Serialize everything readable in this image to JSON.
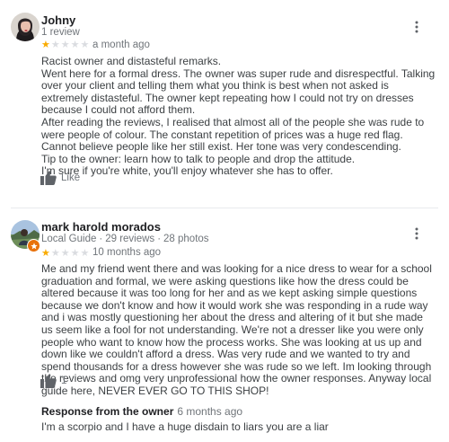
{
  "reviews": [
    {
      "author": "Johny",
      "meta": "1 review",
      "rating": 1,
      "time": "a month ago",
      "text": [
        "Racist owner and distasteful remarks.",
        "Went here for a formal dress. The owner was super rude and disrespectful. Talking over your client and telling them what you think is best when not asked is extremely distasteful. The owner kept repeating how I could not try on dresses because I could not afford them.",
        "After reading the reviews, I realised that almost all of the people she was rude to were people of colour. The constant repetition of prices was a huge red flag. Cannot believe people like her still exist. Her tone was very condescending.",
        "Tip to the owner: learn how to talk to people and drop the attitude.",
        "I'm sure if you're white, you'll enjoy whatever she has to offer."
      ],
      "like_label": "Like"
    },
    {
      "author": "mark harold morados",
      "meta_badge": "Local Guide",
      "meta_reviews": "29 reviews",
      "meta_photos": "28 photos",
      "rating": 1,
      "time": "10 months ago",
      "text": [
        "Me and my friend went there and was looking for a nice dress to wear for a school graduation and formal, we were asking questions like how the dress could be altered because it was too long for her and as we kept asking simple questions because we don't know and how it would work she was responding in a rude way and i was mostly questioning her about the dress and altering of it but she made us seem like a fool for not understanding. We're not a dresser like you were only people who want to know how the process works. She was looking at us up and down like we couldn't afford a dress. Was very rude and we wanted to try and spend thousands for a dress however she was rude so we left. Im looking through the reviews and omg very unprofessional how the owner responses. Anyway local guide here, NEVER EVER GO TO THIS SHOP!"
      ],
      "like_count": "1",
      "response": {
        "title": "Response from the owner",
        "time": "6 months ago",
        "text": "I'm a scorpio and I have a huge disdain to liars you are a liar"
      }
    }
  ],
  "colors": {
    "star": "#f9ab00",
    "star_empty": "#dadce0",
    "badge": "#e8710a",
    "muted": "#70757a"
  },
  "icons": {
    "more": "more-vert-icon",
    "like": "thumb-up-icon",
    "badge": "local-guide-star-icon"
  }
}
